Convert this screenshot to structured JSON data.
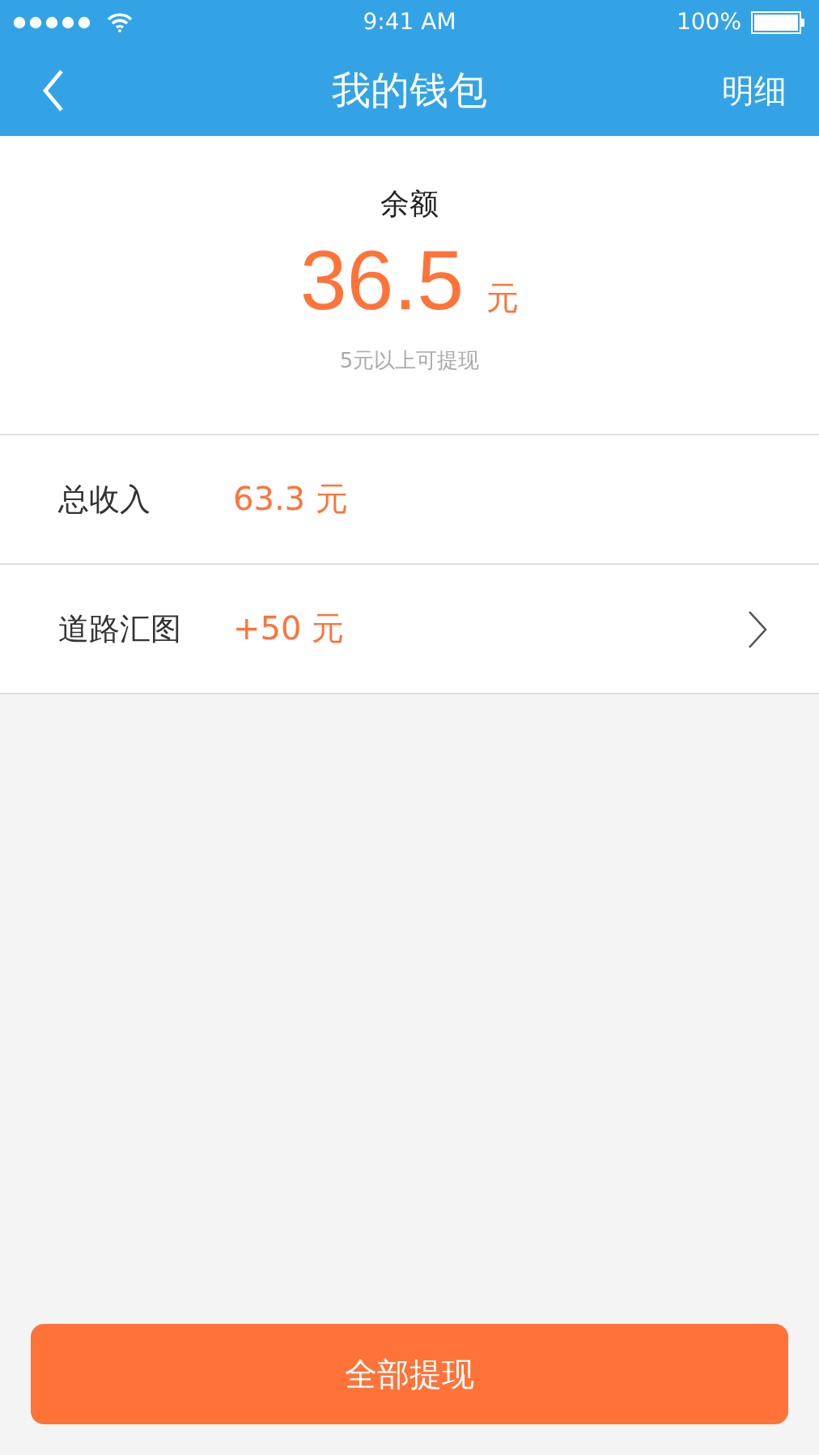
{
  "status_bar": {
    "time": "9:41 AM",
    "battery": "100%"
  },
  "nav": {
    "title": "我的钱包",
    "action": "明细"
  },
  "balance": {
    "label": "余额",
    "amount": "36.5",
    "unit": "元",
    "note": "5元以上可提现"
  },
  "rows": [
    {
      "kind": "plain",
      "label": "总收入",
      "value": "63.3 元"
    },
    {
      "kind": "link",
      "label": "道路汇图",
      "value": "+50 元"
    }
  ],
  "withdraw_button": "全部提现"
}
